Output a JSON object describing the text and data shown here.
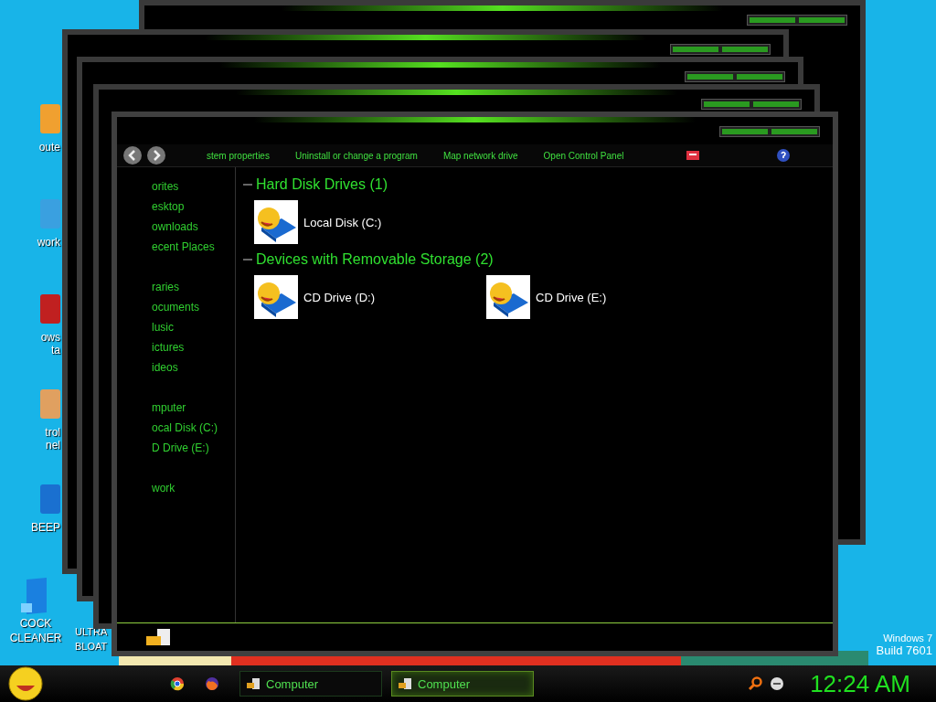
{
  "desktop": {
    "icons": [
      {
        "lines": [
          "oute"
        ]
      },
      {
        "lines": [
          "work"
        ]
      },
      {
        "lines": [
          "ows",
          "ta"
        ]
      },
      {
        "lines": [
          "trol",
          "nel"
        ]
      },
      {
        "lines": [
          "BEEP"
        ]
      }
    ],
    "bottom_icons": [
      {
        "lines": [
          "COCK",
          "CLEANER"
        ]
      },
      {
        "lines": [
          "ULTRA",
          "BLOAT"
        ]
      }
    ],
    "watermark": [
      "Windows 7",
      "Build 7601"
    ]
  },
  "window": {
    "tasks": [
      "stem properties",
      "Uninstall or change a program",
      "Map network drive",
      "Open Control Panel"
    ],
    "sidebar": [
      {
        "items": [
          "orites",
          "esktop",
          "ownloads",
          "ecent Places"
        ]
      },
      {
        "items": [
          "raries",
          "ocuments",
          "lusic",
          "ictures",
          "ideos"
        ]
      },
      {
        "items": [
          "mputer",
          "ocal Disk (C:)",
          "D Drive (E:)"
        ]
      },
      {
        "items": [
          "work"
        ]
      }
    ],
    "groups": [
      {
        "title": "Hard Disk Drives (1)",
        "items": [
          "Local Disk (C:)"
        ]
      },
      {
        "title": "Devices with Removable Storage (2)",
        "items": [
          "CD Drive (D:)",
          "CD Drive (E:)"
        ]
      }
    ]
  },
  "taskbar": {
    "buttons": [
      {
        "label": "Computer",
        "selected": false
      },
      {
        "label": "Computer",
        "selected": true
      }
    ],
    "clock": "12:24 AM"
  }
}
